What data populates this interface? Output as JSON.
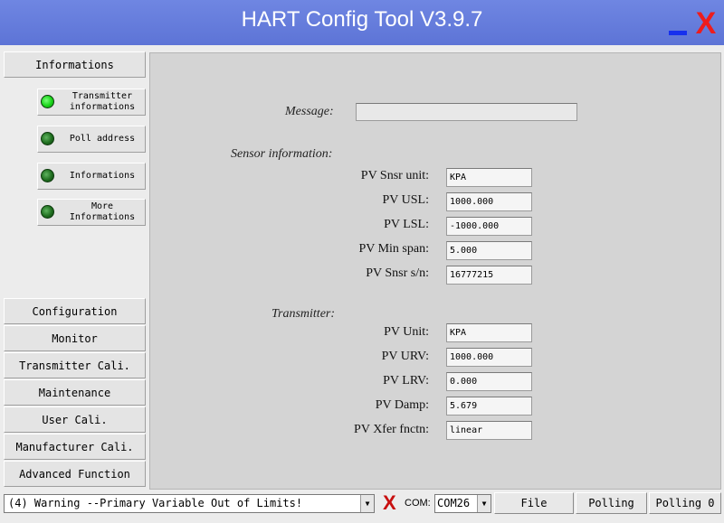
{
  "window": {
    "title": "HART Config Tool  V3.9.7",
    "minimize_icon": "minimize-icon",
    "close_icon": "close-x-icon",
    "close_glyph": "X"
  },
  "sidebar": {
    "informations_label": "Informations",
    "sub_items": [
      {
        "label": "Transmitter\ninformations",
        "indicator": "bright-green"
      },
      {
        "label": "Poll address",
        "indicator": "dark-green"
      },
      {
        "label": "Informations",
        "indicator": "dark-green"
      },
      {
        "label": "More\nInformations",
        "indicator": "dark-green"
      }
    ],
    "bottom_items": [
      {
        "label": "Configuration"
      },
      {
        "label": "Monitor"
      },
      {
        "label": "Transmitter Cali."
      },
      {
        "label": "Maintenance"
      },
      {
        "label": "User Cali."
      },
      {
        "label": "Manufacturer Cali."
      },
      {
        "label": "Advanced Function"
      }
    ]
  },
  "main": {
    "message_label": "Message:",
    "message_value": "",
    "sensor_section": "Sensor information:",
    "sensor_fields": [
      {
        "label": "PV Snsr unit:",
        "value": "KPA"
      },
      {
        "label": "PV USL:",
        "value": "1000.000"
      },
      {
        "label": "PV LSL:",
        "value": "-1000.000"
      },
      {
        "label": "PV Min span:",
        "value": "5.000"
      },
      {
        "label": "PV Snsr s/n:",
        "value": "16777215"
      }
    ],
    "transmitter_section": "Transmitter:",
    "transmitter_fields": [
      {
        "label": "PV Unit:",
        "value": "KPA"
      },
      {
        "label": "PV URV:",
        "value": "1000.000"
      },
      {
        "label": "PV LRV:",
        "value": "0.000"
      },
      {
        "label": "PV Damp:",
        "value": "5.679"
      },
      {
        "label": "PV Xfer fnctn:",
        "value": "linear"
      }
    ]
  },
  "statusbar": {
    "warning": "(4) Warning --Primary Variable Out of Limits!",
    "error_icon": "red-x-icon",
    "error_glyph": "X",
    "com_label": "COM:",
    "com_value": "COM26",
    "file_label": "File",
    "polling_label": "Polling",
    "polling_status": "Polling 0"
  },
  "colors": {
    "titlebar": "#6279da",
    "minimize": "#1630ee",
    "close": "#ee1c1c",
    "indicator_bright": "#18d318",
    "indicator_dark": "#1f6e1f"
  }
}
